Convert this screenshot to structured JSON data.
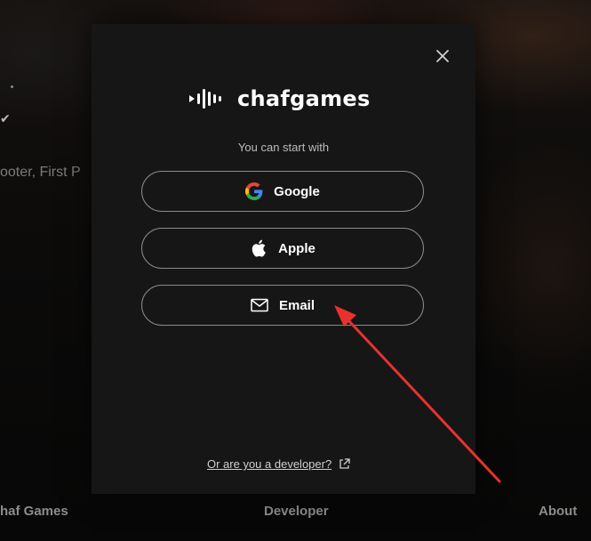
{
  "background": {
    "genres_text": "ooter, First P",
    "footer": {
      "brand": "haf Games",
      "developer": "Developer",
      "about": "About"
    }
  },
  "modal": {
    "logo_text": "chafgames",
    "subtitle": "You can start with",
    "buttons": {
      "google": "Google",
      "apple": "Apple",
      "email": "Email"
    },
    "developer_link": "Or are you a developer?",
    "close_icon": "close-icon"
  },
  "colors": {
    "modal_bg": "#161616",
    "button_border": "#8a8a8a",
    "annotation_arrow": "#e8322e"
  }
}
